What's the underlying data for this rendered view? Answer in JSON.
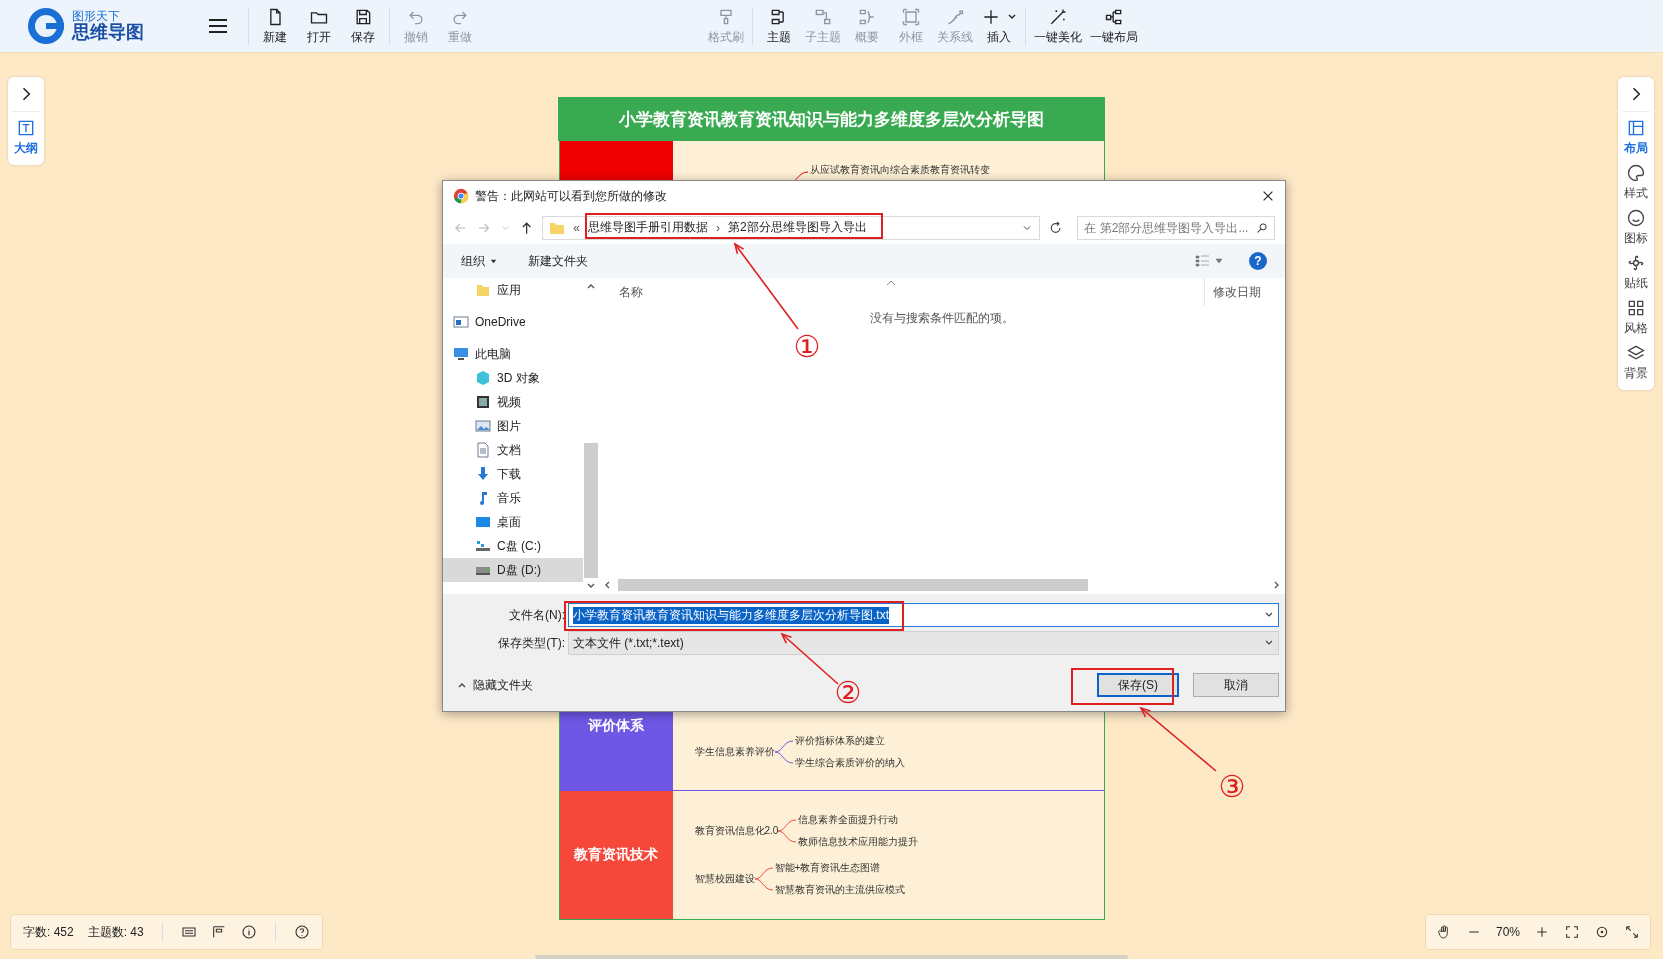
{
  "app": {
    "brand_small": "图形天下",
    "brand_name": "思维导图"
  },
  "toolbar_groups": [
    [
      {
        "label": "新建",
        "disabled": false
      },
      {
        "label": "打开",
        "disabled": false
      },
      {
        "label": "保存",
        "disabled": false
      }
    ],
    [
      {
        "label": "撤销",
        "disabled": true
      },
      {
        "label": "重做",
        "disabled": true
      }
    ],
    [
      {
        "label": "格式刷",
        "disabled": true
      }
    ],
    [
      {
        "label": "主题",
        "disabled": false
      },
      {
        "label": "子主题",
        "disabled": true
      },
      {
        "label": "概要",
        "disabled": true
      },
      {
        "label": "外框",
        "disabled": true
      },
      {
        "label": "关系线",
        "disabled": true
      },
      {
        "label": "插入",
        "disabled": false,
        "has_menu": true
      }
    ],
    [
      {
        "label": "一键美化",
        "disabled": false
      },
      {
        "label": "一键布局",
        "disabled": false
      }
    ]
  ],
  "left_panel": [
    {
      "label": "大纲",
      "selected": true
    }
  ],
  "right_panel": [
    {
      "label": "布局",
      "selected": true
    },
    {
      "label": "样式",
      "selected": false
    },
    {
      "label": "图标",
      "selected": false
    },
    {
      "label": "贴纸",
      "selected": false
    },
    {
      "label": "风格",
      "selected": false
    },
    {
      "label": "背景",
      "selected": false
    }
  ],
  "mind_map": {
    "title": "小学教育资讯教育资讯知识与能力多维度多层次分析导图",
    "rows": [
      {
        "color": "#ee0000",
        "branches": [
          {
            "children": [
              "从应试教育资讯向综合素质教育资讯转变"
            ]
          }
        ]
      },
      {
        "label": "评价体系",
        "color": "#6f57e6",
        "branches": [
          {
            "parent": "学生信息素养评价",
            "children": [
              "评价指标体系的建立",
              "学生综合素质评价的纳入"
            ]
          }
        ]
      },
      {
        "label": "教育资讯技术",
        "color": "#f5483b",
        "branches": [
          {
            "parent": "教育资讯信息化2.0",
            "children": [
              "信息素养全面提升行动",
              "教师信息技术应用能力提升"
            ]
          },
          {
            "parent": "智慧校园建设",
            "children": [
              "智能+教育资讯生态图谱",
              "智慧教育资讯的主流供应模式"
            ]
          }
        ]
      }
    ]
  },
  "status_bar": {
    "word_count": "字数: 452",
    "topic_count": "主题数: 43",
    "zoom": "70%"
  },
  "dialog": {
    "title": "警告：此网站可以看到您所做的修改",
    "path_prefix": "«",
    "path": [
      "思维导图手册引用数据",
      "第2部分思维导图导入导出"
    ],
    "path_separator": "›",
    "search": {
      "placeholder": "在 第2部分思维导图导入导出..."
    },
    "commands": [
      {
        "label": "组织",
        "has_menu": true
      },
      {
        "label": "新建文件夹",
        "has_menu": false
      }
    ],
    "help": "?",
    "nav": [
      {
        "label": "应用",
        "selected": false
      },
      {
        "label": "OneDrive",
        "selected": false
      },
      {
        "label": "此电脑",
        "selected": false,
        "children": [
          {
            "label": "3D 对象",
            "selected": false
          },
          {
            "label": "视频",
            "selected": false
          },
          {
            "label": "图片",
            "selected": false
          },
          {
            "label": "文档",
            "selected": false
          },
          {
            "label": "下载",
            "selected": false
          },
          {
            "label": "音乐",
            "selected": false
          },
          {
            "label": "桌面",
            "selected": false
          },
          {
            "label": "C盘 (C:)",
            "selected": false
          },
          {
            "label": "D盘 (D:)",
            "selected": true
          }
        ]
      }
    ],
    "columns": [
      "名称",
      "修改日期"
    ],
    "empty_message": "没有与搜索条件匹配的项。",
    "file_name": {
      "label": "文件名(N):",
      "value": "小学教育资讯教育资讯知识与能力多维度多层次分析导图.txt",
      "text_selected": true
    },
    "file_type": {
      "label": "保存类型(T):",
      "value": "文本文件 (*.txt;*.text)"
    },
    "hide_folders": "隐藏文件夹",
    "buttons": [
      {
        "label": "保存(S)",
        "default": true
      },
      {
        "label": "取消",
        "default": false
      }
    ]
  },
  "annotations": [
    {
      "label": "①"
    },
    {
      "label": "②"
    },
    {
      "label": "③"
    }
  ]
}
